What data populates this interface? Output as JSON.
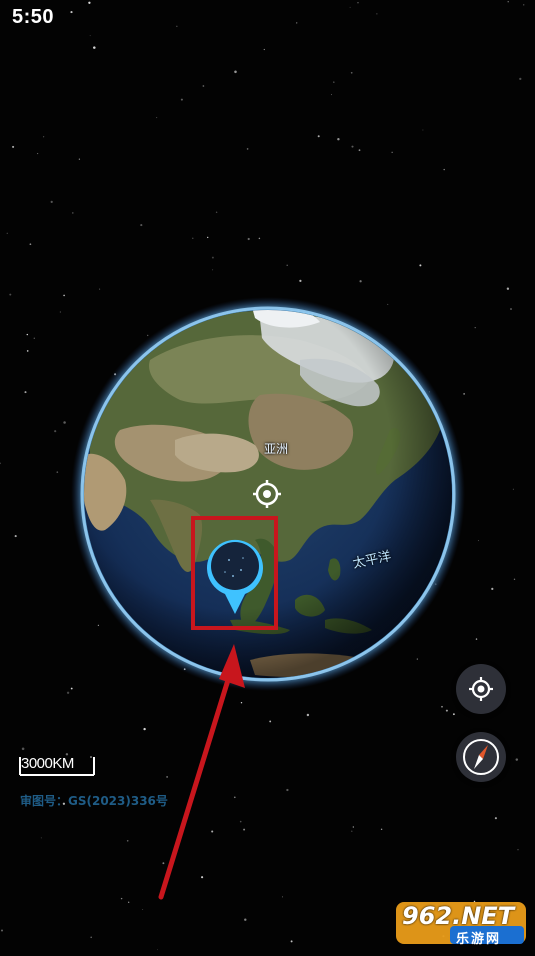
{
  "status_bar": {
    "time": "5:50"
  },
  "map": {
    "labels": {
      "asia": "亚洲",
      "pacific": "太平洋"
    },
    "scale": "3000KM",
    "approval_number": "审图号：GS(2023)336号"
  },
  "controls": {
    "locate_icon": "crosshair-icon",
    "compass_icon": "compass-icon"
  },
  "annotation": {
    "box_color": "#c8161d",
    "arrow_color": "#c8161d"
  },
  "watermark": {
    "brand": "962.NET",
    "subtitle": "乐游网"
  }
}
